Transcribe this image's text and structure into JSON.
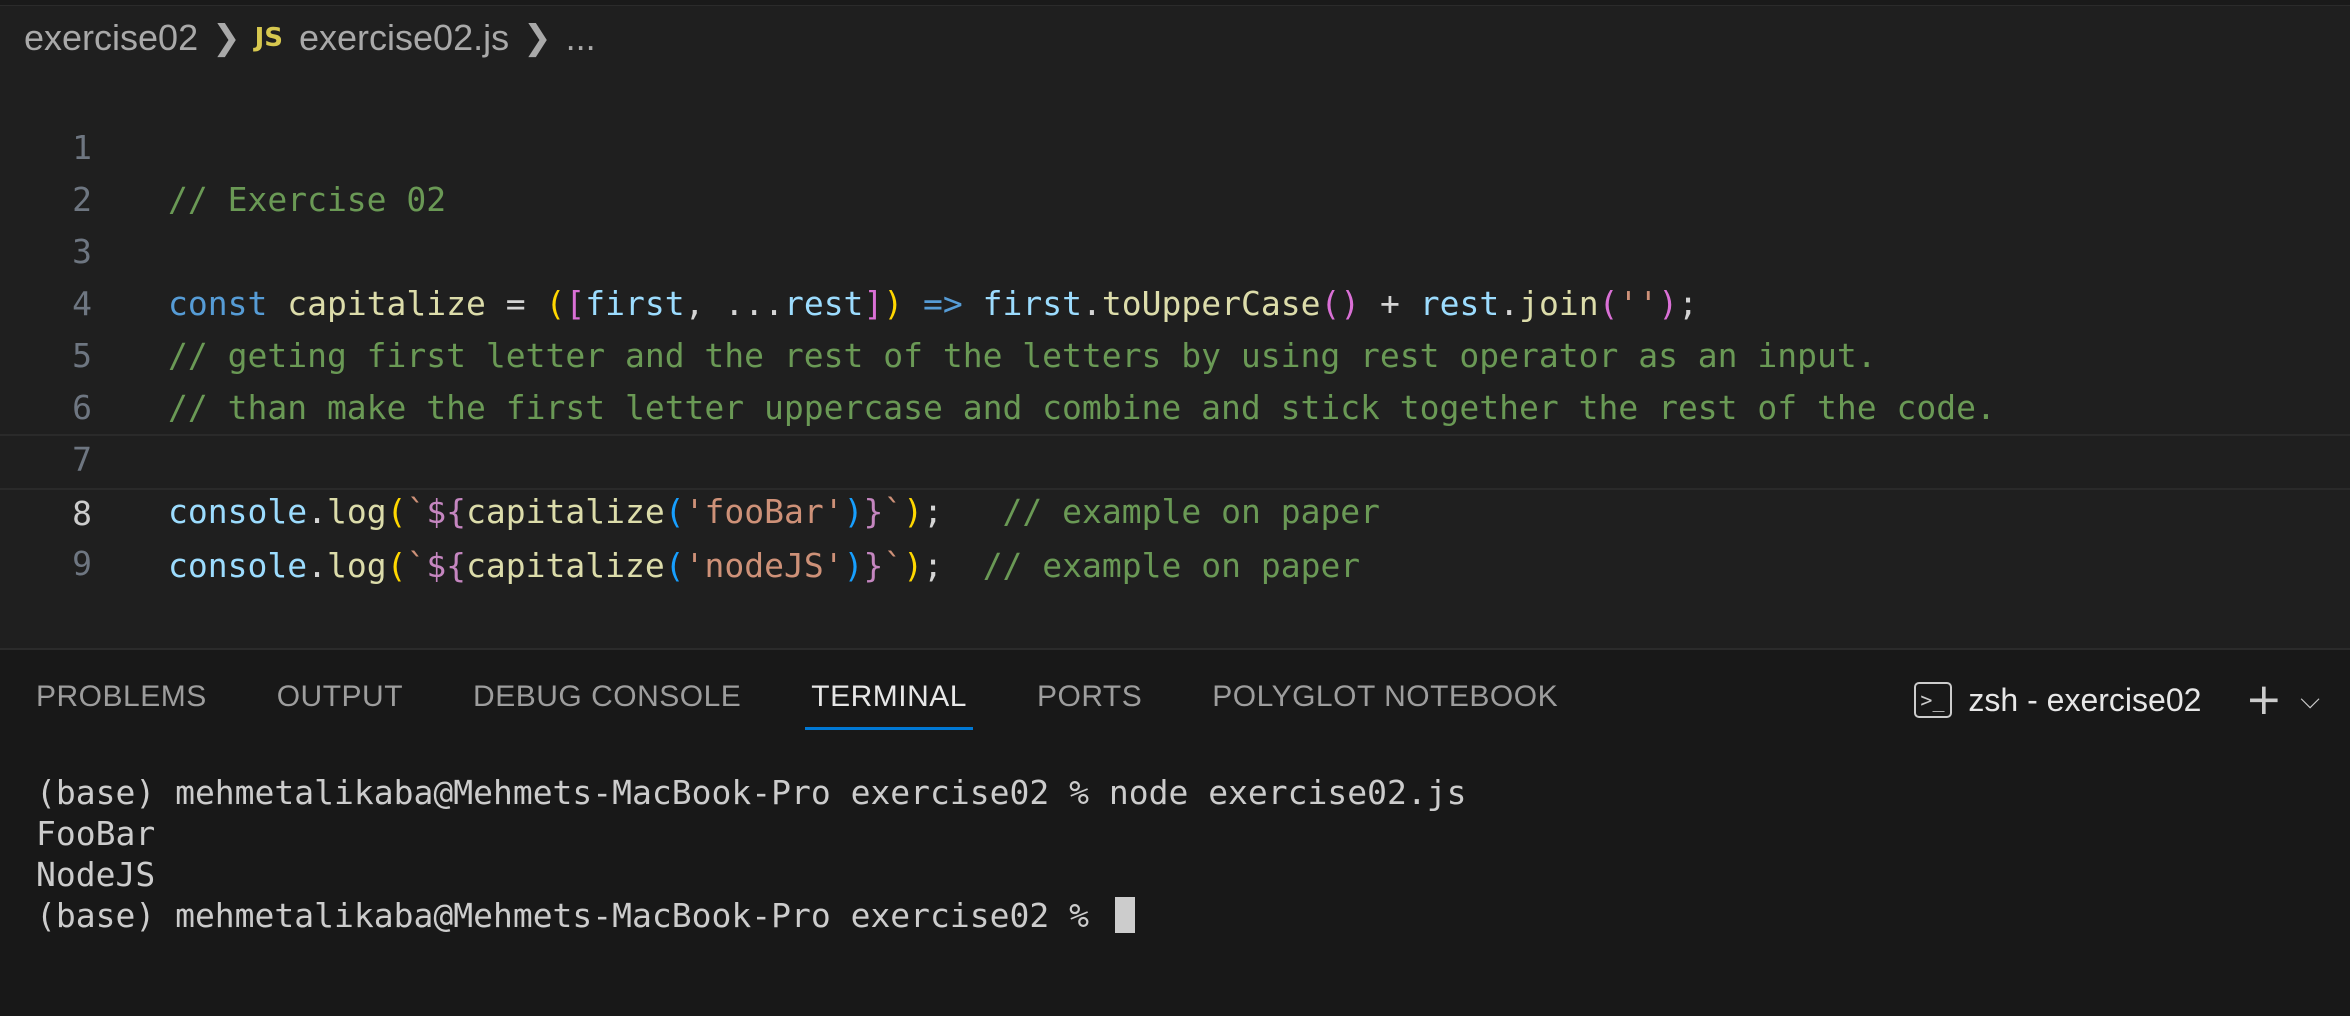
{
  "breadcrumb": {
    "folder": "exercise02",
    "file_icon": "JS",
    "file": "exercise02.js",
    "more": "..."
  },
  "editor": {
    "lines": [
      {
        "num": "1",
        "comment": "// Exercise 02"
      },
      {
        "num": "2"
      },
      {
        "num": "3",
        "t1": "const",
        "t2": "capitalize",
        "t3": " = ",
        "t4": "(",
        "t5": "[",
        "t6": "first",
        "t7": ", ...",
        "t8": "rest",
        "t9": "]",
        "t10": ")",
        "t11": " => ",
        "t12": "first",
        "t13": ".",
        "t14": "toUpperCase",
        "t15": "()",
        "t16": " + ",
        "t17": "rest",
        "t18": ".",
        "t19": "join",
        "t20": "(",
        "t21": "''",
        "t22": ")",
        "t23": ";"
      },
      {
        "num": "4",
        "comment": "// geting first letter and the rest of the letters by using rest operator as an input."
      },
      {
        "num": "5",
        "comment": "// than make the first letter uppercase and combine and stick together the rest of the code."
      },
      {
        "num": "6"
      },
      {
        "num": "7",
        "obj": "console",
        "dot": ".",
        "method": "log",
        "p1": "(",
        "bt1": "`",
        "ds": "${",
        "call": "capitalize",
        "p2": "(",
        "arg": "'fooBar'",
        "p3": ")",
        "cb": "}",
        "bt2": "`",
        "p4": ")",
        "semi": ";",
        "comment": "   // example on paper"
      },
      {
        "num": "8",
        "obj": "console",
        "dot": ".",
        "method": "log",
        "p1": "(",
        "bt1": "`",
        "ds": "${",
        "call": "capitalize",
        "p2": "(",
        "arg": "'nodeJS'",
        "p3": ")",
        "cb": "}",
        "bt2": "`",
        "p4": ")",
        "semi": ";",
        "comment": "  // example on paper"
      },
      {
        "num": "9"
      }
    ]
  },
  "panel": {
    "tabs": [
      "PROBLEMS",
      "OUTPUT",
      "DEBUG CONSOLE",
      "TERMINAL",
      "PORTS",
      "POLYGLOT NOTEBOOK"
    ],
    "active_tab": "TERMINAL",
    "terminal_name": "zsh - exercise02",
    "icons": {
      "terminal": "terminal-icon",
      "add": "plus-icon",
      "dropdown": "chevron-down-icon"
    }
  },
  "terminal": {
    "lines": [
      "(base) mehmetalikaba@Mehmets-MacBook-Pro exercise02 % node exercise02.js",
      "FooBar",
      "NodeJS",
      "(base) mehmetalikaba@Mehmets-MacBook-Pro exercise02 % "
    ]
  },
  "colors": {
    "background": "#1f1f1f",
    "comment": "#6a9955",
    "keyword": "#569cd6",
    "function": "#dcdcaa",
    "variable": "#9cdcfe",
    "string": "#ce9178",
    "active_tab_underline": "#0078d4"
  }
}
